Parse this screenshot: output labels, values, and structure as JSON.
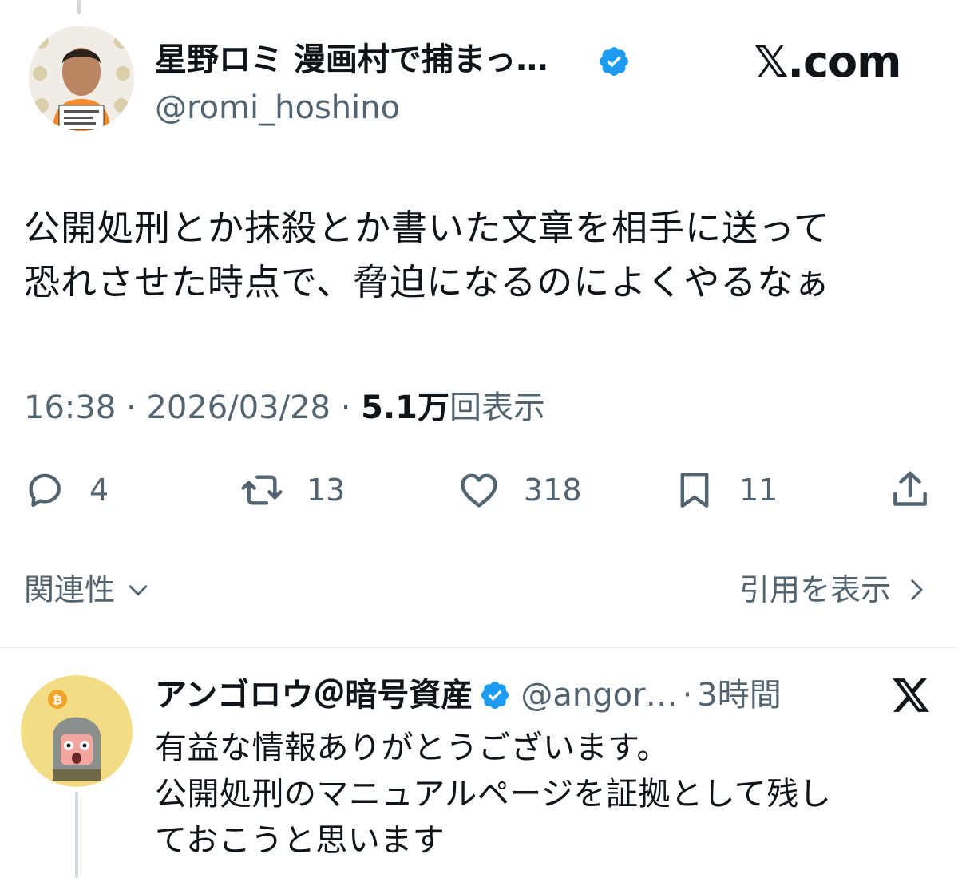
{
  "tweet": {
    "author_name": "星野ロミ 漫画村で捕まっ…",
    "author_handle": "@romi_hoshino",
    "verified": true,
    "logo_text": "𝕏.com",
    "text_lines": [
      "公開処刑とか抹殺とか書いた文章を相手に送って",
      "恐れさせた時点で、脅迫になるのによくやるなぁ"
    ],
    "time": "16:38",
    "separator": " · ",
    "date": "2026/03/28",
    "views_count": "5.1万",
    "views_label": "回表示",
    "stats": {
      "replies": "4",
      "reposts": "13",
      "likes": "318",
      "bookmarks": "11"
    },
    "relevance_label": "関連性",
    "view_quotes_label": "引用を表示"
  },
  "reply": {
    "author_name": "アンゴロウ＠暗号資産",
    "verified": true,
    "handle": "@angor…",
    "separator": "·",
    "time": "3時間",
    "text_lines": [
      "有益な情報ありがとうございます。",
      "公開処刑のマニュアルページを証拠として残し",
      "ておこうと思います"
    ]
  },
  "colors": {
    "text_primary": "#0f1419",
    "text_secondary": "#536471",
    "verified_blue": "#1d9bf0",
    "divider": "#eff3f4",
    "thread_line": "#cfd9de"
  },
  "icons": {
    "reply": "speech-bubble-icon",
    "repost": "repost-arrows-icon",
    "like": "heart-icon",
    "bookmark": "bookmark-icon",
    "share": "share-upload-icon",
    "verified": "verified-badge-icon",
    "relevance_chevron": "chevron-down-icon",
    "quotes_chevron": "chevron-right-icon",
    "x_logo": "x-logo-icon"
  }
}
